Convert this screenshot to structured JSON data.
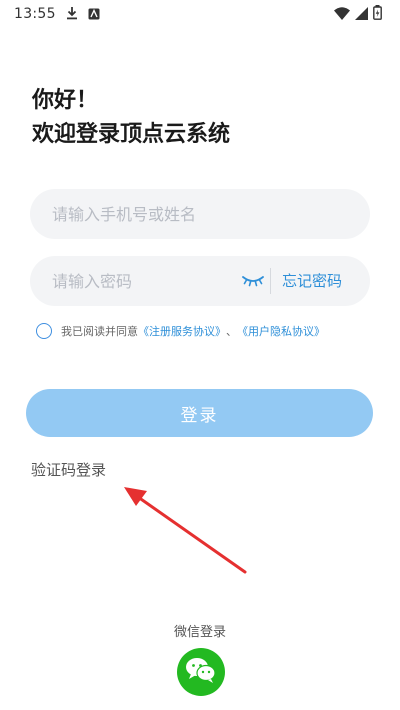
{
  "status_bar": {
    "time": "13:55",
    "left_icons": [
      "download-icon",
      "app-notification-icon"
    ],
    "right_icons": [
      "wifi-icon",
      "signal-icon",
      "battery-icon"
    ]
  },
  "greeting": {
    "line1": "你好！",
    "line2": "欢迎登录顶点云系统"
  },
  "phone_input": {
    "placeholder": "请输入手机号或姓名",
    "value": ""
  },
  "password_input": {
    "placeholder": "请输入密码",
    "value": ""
  },
  "forgot_password": "忘记密码",
  "agreement": {
    "prefix": "我已阅读并同意",
    "service_link": "《注册服务协议》",
    "separator": "、",
    "privacy_link": "《用户隐私协议》",
    "checked": false
  },
  "login_button": "登录",
  "sms_login": "验证码登录",
  "wechat": {
    "label": "微信登录",
    "icon": "wechat-icon"
  },
  "colors": {
    "accent": "#2e8fd8",
    "login_button": "#93c9f3",
    "input_background": "#f3f4f6",
    "wechat_green": "#23b921",
    "annotation_arrow": "#e53030"
  }
}
